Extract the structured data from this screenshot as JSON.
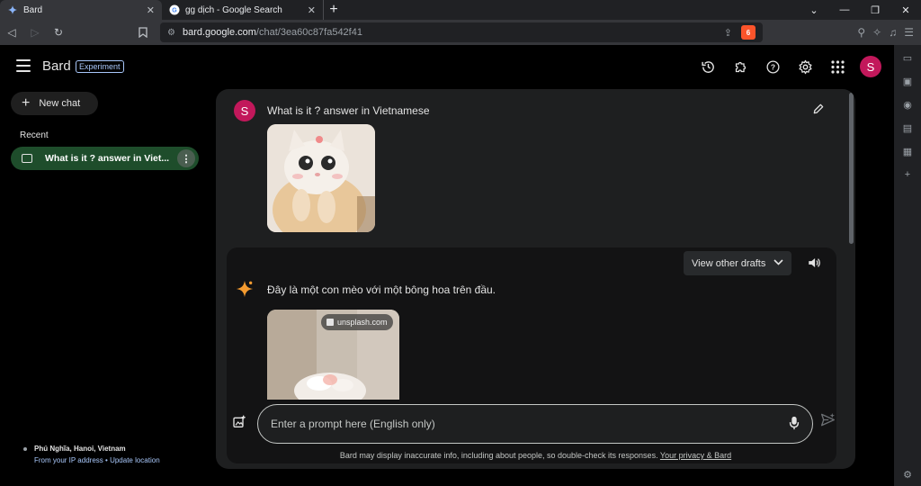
{
  "browser": {
    "tabs": [
      {
        "title": "Bard",
        "active": true
      },
      {
        "title": "gg dịch - Google Search",
        "active": false
      }
    ],
    "url_domain": "bard.google.com",
    "url_path": "/chat/3ea60c87fa542f41",
    "brave_badge": "6"
  },
  "header": {
    "brand": "Bard",
    "badge": "Experiment",
    "avatar_letter": "S"
  },
  "sidebar": {
    "new_chat_label": "New chat",
    "recent_label": "Recent",
    "recent_items": [
      {
        "label": "What is it ? answer in Viet..."
      }
    ],
    "location": {
      "place": "Phú Nghĩa, Hanoi, Vietnam",
      "from_ip": "From your IP address",
      "separator": "•",
      "update_link": "Update location"
    }
  },
  "chat": {
    "user_avatar_letter": "S",
    "question": "What is it ? answer in Vietnamese",
    "drafts_label": "View other drafts",
    "answer": "Đây là một con mèo với một bông hoa trên đầu.",
    "image_source": "unsplash.com",
    "prompt_placeholder": "Enter a prompt here (English only)",
    "disclaimer": "Bard may display inaccurate info, including about people, so double-check its responses.",
    "privacy_link": "Your privacy & Bard"
  },
  "colors": {
    "accent_blue": "#a8c7fa",
    "avatar_pink": "#c2185b",
    "recent_active_green": "#1e4d2b",
    "panel_bg": "#1e1f20",
    "sparkle_orange": "#f59b30"
  }
}
